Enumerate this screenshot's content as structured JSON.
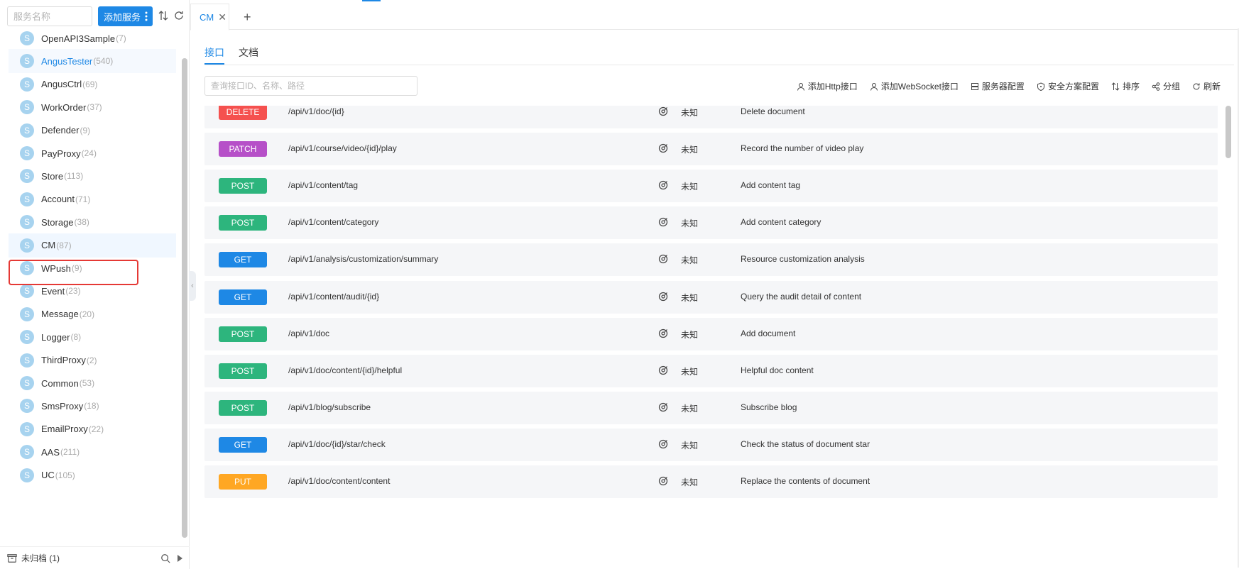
{
  "sidebar": {
    "search_placeholder": "服务名称",
    "add_service_label": "添加服务",
    "services": [
      {
        "name": "OpenAPI3Sample",
        "count": "(7)"
      },
      {
        "name": "AngusTester",
        "count": "(540)"
      },
      {
        "name": "AngusCtrl",
        "count": "(69)"
      },
      {
        "name": "WorkOrder",
        "count": "(37)"
      },
      {
        "name": "Defender",
        "count": "(9)"
      },
      {
        "name": "PayProxy",
        "count": "(24)"
      },
      {
        "name": "Store",
        "count": "(113)"
      },
      {
        "name": "Account",
        "count": "(71)"
      },
      {
        "name": "Storage",
        "count": "(38)"
      },
      {
        "name": "CM",
        "count": "(87)"
      },
      {
        "name": "WPush",
        "count": "(9)"
      },
      {
        "name": "Event",
        "count": "(23)"
      },
      {
        "name": "Message",
        "count": "(20)"
      },
      {
        "name": "Logger",
        "count": "(8)"
      },
      {
        "name": "ThirdProxy",
        "count": "(2)"
      },
      {
        "name": "Common",
        "count": "(53)"
      },
      {
        "name": "SmsProxy",
        "count": "(18)"
      },
      {
        "name": "EmailProxy",
        "count": "(22)"
      },
      {
        "name": "AAS",
        "count": "(211)"
      },
      {
        "name": "UC",
        "count": "(105)"
      }
    ],
    "service_badge": "S",
    "unarchived_label": "未归档 (1)"
  },
  "tabs": {
    "active_label": "CM",
    "close_glyph": "✕",
    "add_glyph": "+"
  },
  "subtabs": {
    "api_label": "接口",
    "doc_label": "文档"
  },
  "api_search_placeholder": "查询接口ID、名称、路径",
  "toolbar": {
    "add_http": "添加Http接口",
    "add_websocket": "添加WebSocket接口",
    "server_config": "服务器配置",
    "security_config": "安全方案配置",
    "sort": "排序",
    "group": "分组",
    "refresh": "刷新"
  },
  "method_colors": {
    "DELETE": "#f5514f",
    "PATCH": "#b650c8",
    "POST": "#2db57d",
    "GET": "#1e88e5",
    "PUT": "#ffa723"
  },
  "apis": [
    {
      "method": "DELETE",
      "path": "/api/v1/doc/{id}",
      "status": "未知",
      "desc": "Delete document"
    },
    {
      "method": "PATCH",
      "path": "/api/v1/course/video/{id}/play",
      "status": "未知",
      "desc": "Record the number of video play"
    },
    {
      "method": "POST",
      "path": "/api/v1/content/tag",
      "status": "未知",
      "desc": "Add content tag"
    },
    {
      "method": "POST",
      "path": "/api/v1/content/category",
      "status": "未知",
      "desc": "Add content category"
    },
    {
      "method": "GET",
      "path": "/api/v1/analysis/customization/summary",
      "status": "未知",
      "desc": "Resource customization analysis"
    },
    {
      "method": "GET",
      "path": "/api/v1/content/audit/{id}",
      "status": "未知",
      "desc": "Query the audit detail of content"
    },
    {
      "method": "POST",
      "path": "/api/v1/doc",
      "status": "未知",
      "desc": "Add document"
    },
    {
      "method": "POST",
      "path": "/api/v1/doc/content/{id}/helpful",
      "status": "未知",
      "desc": "Helpful doc content"
    },
    {
      "method": "POST",
      "path": "/api/v1/blog/subscribe",
      "status": "未知",
      "desc": "Subscribe blog"
    },
    {
      "method": "GET",
      "path": "/api/v1/doc/{id}/star/check",
      "status": "未知",
      "desc": "Check the status of document star"
    },
    {
      "method": "PUT",
      "path": "/api/v1/doc/content/content",
      "status": "未知",
      "desc": "Replace the contents of document"
    }
  ]
}
